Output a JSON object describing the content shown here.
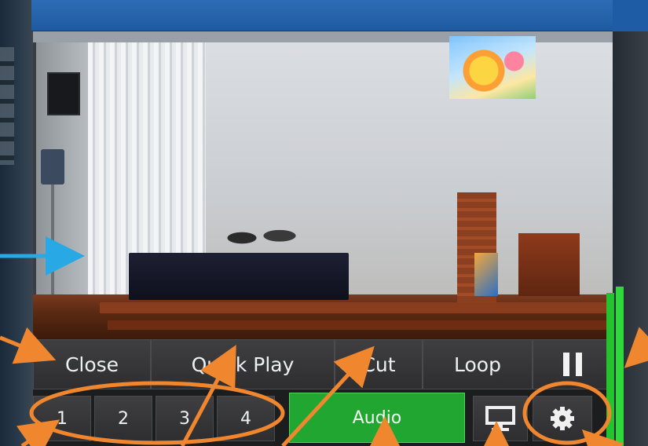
{
  "controls": {
    "row1": {
      "close_label": "Close",
      "quick_play_label": "Quick Play",
      "cut_label": "Cut",
      "loop_label": "Loop",
      "pause_icon": "pause-icon"
    },
    "row2": {
      "presets": [
        "1",
        "2",
        "3",
        "4"
      ],
      "audio_label": "Audio",
      "display_icon": "monitor-icon",
      "settings_icon": "gear-icon"
    }
  },
  "audio_level": {
    "left": 0.96,
    "right": 1.0
  },
  "colors": {
    "audio_active": "#22a632",
    "annotation_orange": "#f0862e",
    "annotation_blue": "#29a8e6",
    "title_bar": "#1f5aa0"
  }
}
